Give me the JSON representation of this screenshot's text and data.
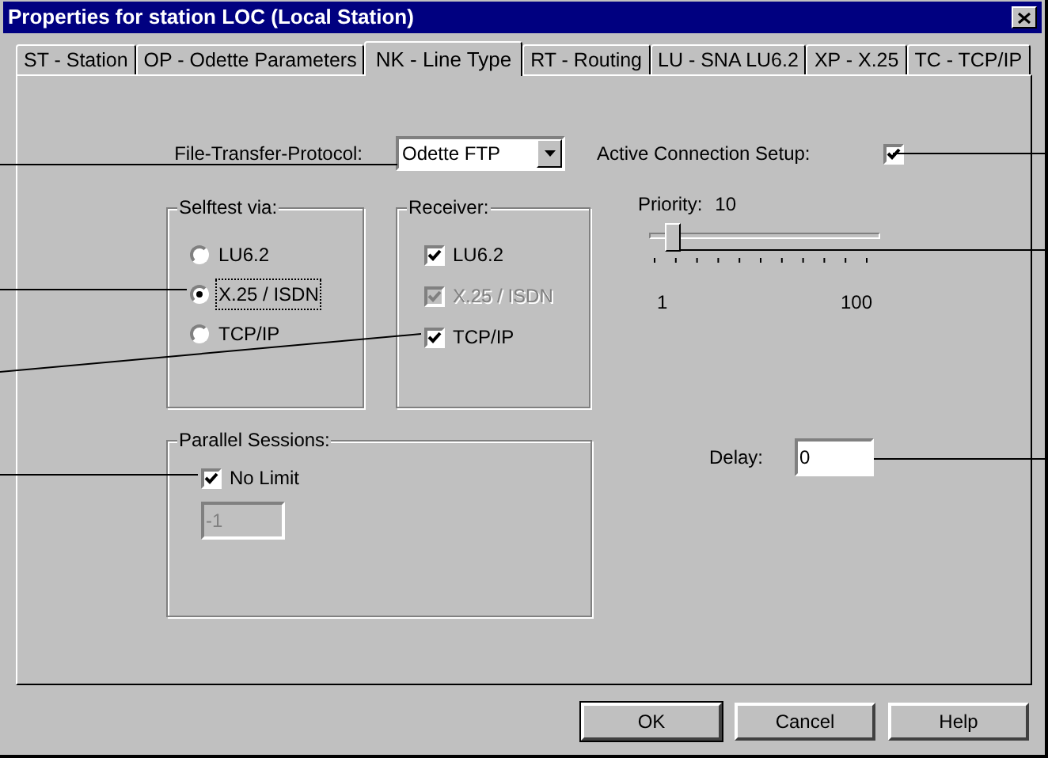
{
  "window": {
    "title": "Properties for station LOC (Local Station)"
  },
  "tabs": [
    {
      "label": "ST - Station",
      "selected": false
    },
    {
      "label": "OP - Odette Parameters",
      "selected": false
    },
    {
      "label": "NK - Line Type",
      "selected": true
    },
    {
      "label": "RT - Routing",
      "selected": false
    },
    {
      "label": "LU - SNA LU6.2",
      "selected": false
    },
    {
      "label": "XP - X.25",
      "selected": false
    },
    {
      "label": "TC - TCP/IP",
      "selected": false
    }
  ],
  "ftp": {
    "label": "File-Transfer-Protocol:",
    "value": "Odette FTP"
  },
  "active_connection": {
    "label": "Active Connection Setup:",
    "checked": true
  },
  "selftest": {
    "title": "Selftest via:",
    "options": [
      {
        "label": "LU6.2",
        "selected": false,
        "focused": false
      },
      {
        "label": "X.25 / ISDN",
        "selected": true,
        "focused": true
      },
      {
        "label": "TCP/IP",
        "selected": false,
        "focused": false
      }
    ]
  },
  "receiver": {
    "title": "Receiver:",
    "items": [
      {
        "label": "LU6.2",
        "checked": true,
        "disabled": false
      },
      {
        "label": "X.25 / ISDN",
        "checked": true,
        "disabled": true
      },
      {
        "label": "TCP/IP",
        "checked": true,
        "disabled": false
      }
    ]
  },
  "priority": {
    "label": "Priority:",
    "reading": "10",
    "level": 0.09,
    "min_label": "1",
    "max_label": "100"
  },
  "parallel_sessions": {
    "title": "Parallel Sessions:",
    "no_limit": {
      "label": "No Limit",
      "checked": true
    },
    "count": {
      "value": "-1",
      "disabled": true
    }
  },
  "delay": {
    "label": "Delay:",
    "value": "0"
  },
  "buttons": [
    {
      "label": "OK",
      "default": true
    },
    {
      "label": "Cancel",
      "default": false
    },
    {
      "label": "Help",
      "default": false
    }
  ]
}
